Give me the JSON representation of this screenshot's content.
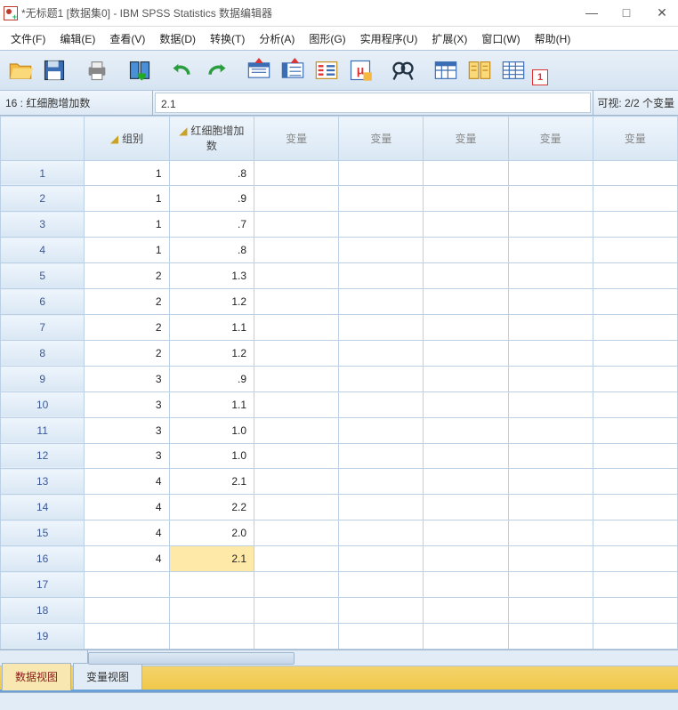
{
  "title": "*无标题1 [数据集0] - IBM SPSS Statistics 数据编辑器",
  "menu": [
    "文件(F)",
    "编辑(E)",
    "查看(V)",
    "数据(D)",
    "转换(T)",
    "分析(A)",
    "图形(G)",
    "实用程序(U)",
    "扩展(X)",
    "窗口(W)",
    "帮助(H)"
  ],
  "cellref": {
    "name": "16 : 红细胞增加数",
    "value": "2.1",
    "vis": "可视: 2/2 个变量"
  },
  "columns": [
    "组别",
    "红细胞增加数",
    "变量",
    "变量",
    "变量",
    "变量",
    "变量"
  ],
  "rows": [
    {
      "n": 1,
      "c": [
        "1",
        ".8",
        "",
        "",
        "",
        "",
        ""
      ]
    },
    {
      "n": 2,
      "c": [
        "1",
        ".9",
        "",
        "",
        "",
        "",
        ""
      ]
    },
    {
      "n": 3,
      "c": [
        "1",
        ".7",
        "",
        "",
        "",
        "",
        ""
      ]
    },
    {
      "n": 4,
      "c": [
        "1",
        ".8",
        "",
        "",
        "",
        "",
        ""
      ]
    },
    {
      "n": 5,
      "c": [
        "2",
        "1.3",
        "",
        "",
        "",
        "",
        ""
      ]
    },
    {
      "n": 6,
      "c": [
        "2",
        "1.2",
        "",
        "",
        "",
        "",
        ""
      ]
    },
    {
      "n": 7,
      "c": [
        "2",
        "1.1",
        "",
        "",
        "",
        "",
        ""
      ]
    },
    {
      "n": 8,
      "c": [
        "2",
        "1.2",
        "",
        "",
        "",
        "",
        ""
      ]
    },
    {
      "n": 9,
      "c": [
        "3",
        ".9",
        "",
        "",
        "",
        "",
        ""
      ]
    },
    {
      "n": 10,
      "c": [
        "3",
        "1.1",
        "",
        "",
        "",
        "",
        ""
      ]
    },
    {
      "n": 11,
      "c": [
        "3",
        "1.0",
        "",
        "",
        "",
        "",
        ""
      ]
    },
    {
      "n": 12,
      "c": [
        "3",
        "1.0",
        "",
        "",
        "",
        "",
        ""
      ]
    },
    {
      "n": 13,
      "c": [
        "4",
        "2.1",
        "",
        "",
        "",
        "",
        ""
      ]
    },
    {
      "n": 14,
      "c": [
        "4",
        "2.2",
        "",
        "",
        "",
        "",
        ""
      ]
    },
    {
      "n": 15,
      "c": [
        "4",
        "2.0",
        "",
        "",
        "",
        "",
        ""
      ]
    },
    {
      "n": 16,
      "c": [
        "4",
        "2.1",
        "",
        "",
        "",
        "",
        ""
      ],
      "sel": 1
    },
    {
      "n": 17,
      "c": [
        "",
        "",
        "",
        "",
        "",
        "",
        ""
      ]
    },
    {
      "n": 18,
      "c": [
        "",
        "",
        "",
        "",
        "",
        "",
        ""
      ]
    },
    {
      "n": 19,
      "c": [
        "",
        "",
        "",
        "",
        "",
        "",
        ""
      ]
    }
  ],
  "tabs": {
    "data": "数据视图",
    "var": "变量视图"
  }
}
